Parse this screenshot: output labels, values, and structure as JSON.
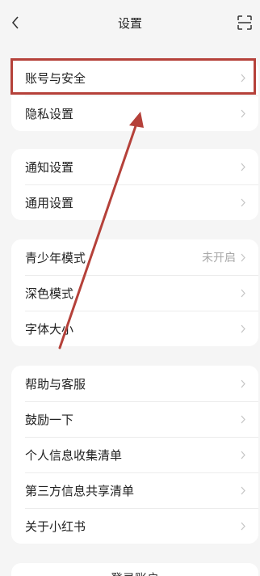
{
  "header": {
    "title": "设置",
    "back_icon": "chevron-left-icon",
    "scan_icon": "scan-icon"
  },
  "groups": [
    {
      "items": [
        {
          "label": "账号与安全"
        },
        {
          "label": "隐私设置"
        }
      ]
    },
    {
      "items": [
        {
          "label": "通知设置"
        },
        {
          "label": "通用设置"
        }
      ]
    },
    {
      "items": [
        {
          "label": "青少年模式",
          "value": "未开启"
        },
        {
          "label": "深色模式"
        },
        {
          "label": "字体大小"
        }
      ]
    },
    {
      "items": [
        {
          "label": "帮助与客服"
        },
        {
          "label": "鼓励一下"
        },
        {
          "label": "个人信息收集清单"
        },
        {
          "label": "第三方信息共享清单"
        },
        {
          "label": "关于小红书"
        }
      ]
    }
  ],
  "footer": {
    "label": "登录账户"
  },
  "colors": {
    "annotation": "#b5413a",
    "background": "#f5f5f5",
    "card": "#ffffff"
  }
}
